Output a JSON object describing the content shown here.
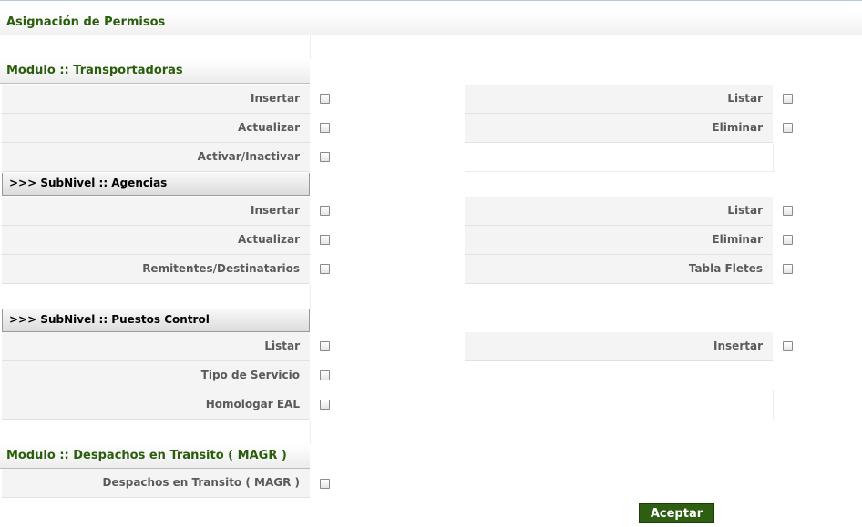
{
  "page": {
    "title": "Asignación de Permisos"
  },
  "module_transportadoras": {
    "title": "Modulo :: Transportadoras",
    "left": [
      "Insertar",
      "Actualizar",
      "Activar/Inactivar"
    ],
    "right": [
      "Listar",
      "Eliminar"
    ]
  },
  "subnivel_agencias": {
    "title": ">>> SubNivel :: Agencias",
    "left": [
      "Insertar",
      "Actualizar",
      "Remitentes/Destinatarios"
    ],
    "right": [
      "Listar",
      "Eliminar",
      "Tabla Fletes"
    ]
  },
  "subnivel_puestos": {
    "title": ">>> SubNivel :: Puestos Control",
    "left": [
      "Listar",
      "Tipo de Servicio",
      "Homologar EAL"
    ],
    "right": [
      "Insertar"
    ]
  },
  "module_despachos": {
    "title": "Modulo :: Despachos en Transito ( MAGR )",
    "left": [
      "Despachos en Transito ( MAGR )"
    ]
  },
  "buttons": {
    "accept": "Aceptar"
  }
}
